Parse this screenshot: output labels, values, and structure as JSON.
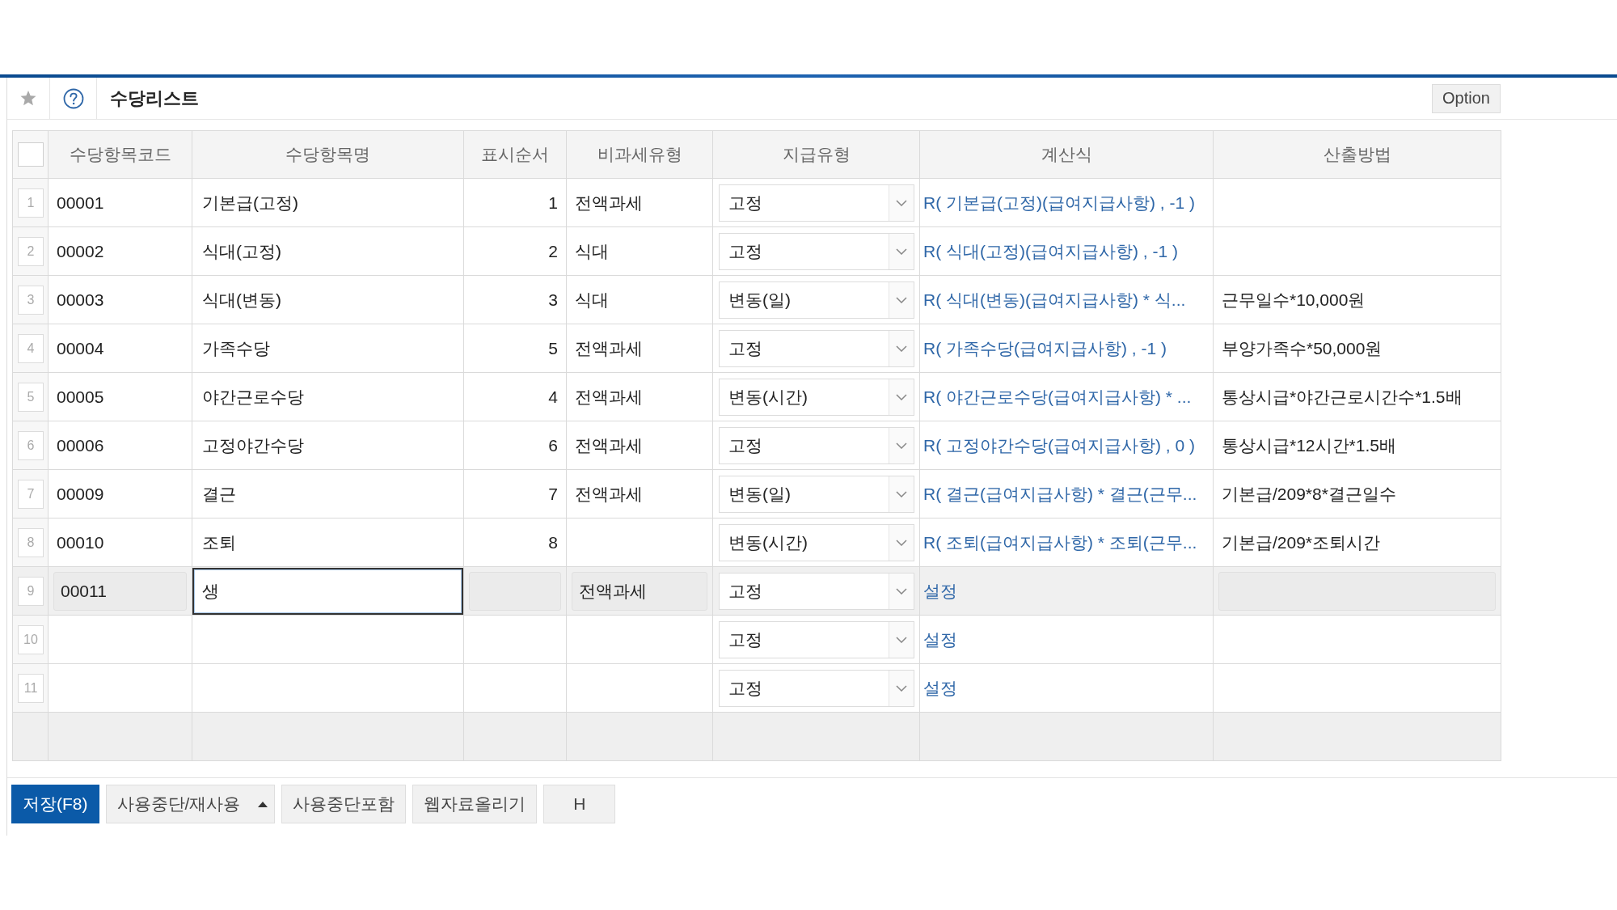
{
  "toolbar": {
    "title": "수당리스트",
    "option_button": "Option"
  },
  "table": {
    "select_all": {
      "checked": false
    },
    "columns": [
      "수당항목코드",
      "수당항목명",
      "표시순서",
      "비과세유형",
      "지급유형",
      "계산식",
      "산출방법"
    ],
    "rows": [
      {
        "number": "1",
        "code": "00001",
        "name": "기본급(고정)",
        "order": "1",
        "tax_free_type": "전액과세",
        "payment_type": "고정",
        "formula": "R( 기본급(고정)(급여지급사항) , -1 )",
        "editing": false
      },
      {
        "number": "2",
        "code": "00002",
        "name": "식대(고정)",
        "order": "2",
        "tax_free_type": "식대",
        "payment_type": "고정",
        "formula": "R( 식대(고정)(급여지급사항) , -1 )",
        "editing": false
      },
      {
        "number": "3",
        "code": "00003",
        "name": "식대(변동)",
        "order": "3",
        "tax_free_type": "식대",
        "payment_type": "변동(일)",
        "formula": "R( 식대(변동)(급여지급사항) * 식...",
        "method": "근무일수*10,000원",
        "editing": false
      },
      {
        "number": "4",
        "code": "00004",
        "name": "가족수당",
        "order": "5",
        "tax_free_type": "전액과세",
        "payment_type": "고정",
        "formula": "R( 가족수당(급여지급사항) , -1 )",
        "method": "부양가족수*50,000원",
        "editing": false
      },
      {
        "number": "5",
        "code": "00005",
        "name": "야간근로수당",
        "order": "4",
        "tax_free_type": "전액과세",
        "payment_type": "변동(시간)",
        "formula": "R( 야간근로수당(급여지급사항) * ...",
        "method": "통상시급*야간근로시간수*1.5배",
        "editing": false
      },
      {
        "number": "6",
        "code": "00006",
        "name": "고정야간수당",
        "order": "6",
        "tax_free_type": "전액과세",
        "payment_type": "고정",
        "formula": "R( 고정야간수당(급여지급사항) , 0 )",
        "method": "통상시급*12시간*1.5배",
        "editing": false
      },
      {
        "number": "7",
        "code": "00009",
        "name": "결근",
        "order": "7",
        "tax_free_type": "전액과세",
        "payment_type": "변동(일)",
        "formula": "R( 결근(급여지급사항) * 결근(근무...",
        "method": "기본급/209*8*결근일수",
        "editing": false
      },
      {
        "number": "8",
        "code": "00010",
        "name": "조퇴",
        "order": "8",
        "payment_type": "변동(시간)",
        "formula": "R( 조퇴(급여지급사항) * 조퇴(근무...",
        "method": "기본급/209*조퇴시간",
        "editing": false
      },
      {
        "number": "9",
        "code": "00011",
        "name": "생",
        "tax_free_type": "전액과세",
        "payment_type": "고정",
        "formula": "설정",
        "editing": true
      },
      {
        "number": "10",
        "payment_type": "고정",
        "formula": "설정",
        "editing": false
      },
      {
        "number": "11",
        "payment_type": "고정",
        "formula": "설정",
        "editing": false
      }
    ]
  },
  "buttons": [
    {
      "label": "저장(F8)",
      "kind": "primary"
    },
    {
      "label": "사용중단/재사용",
      "kind": "menu"
    },
    {
      "label": "사용중단포함",
      "kind": "plain"
    },
    {
      "label": "웹자료올리기",
      "kind": "plain"
    },
    {
      "label": "H",
      "kind": "plain"
    }
  ]
}
